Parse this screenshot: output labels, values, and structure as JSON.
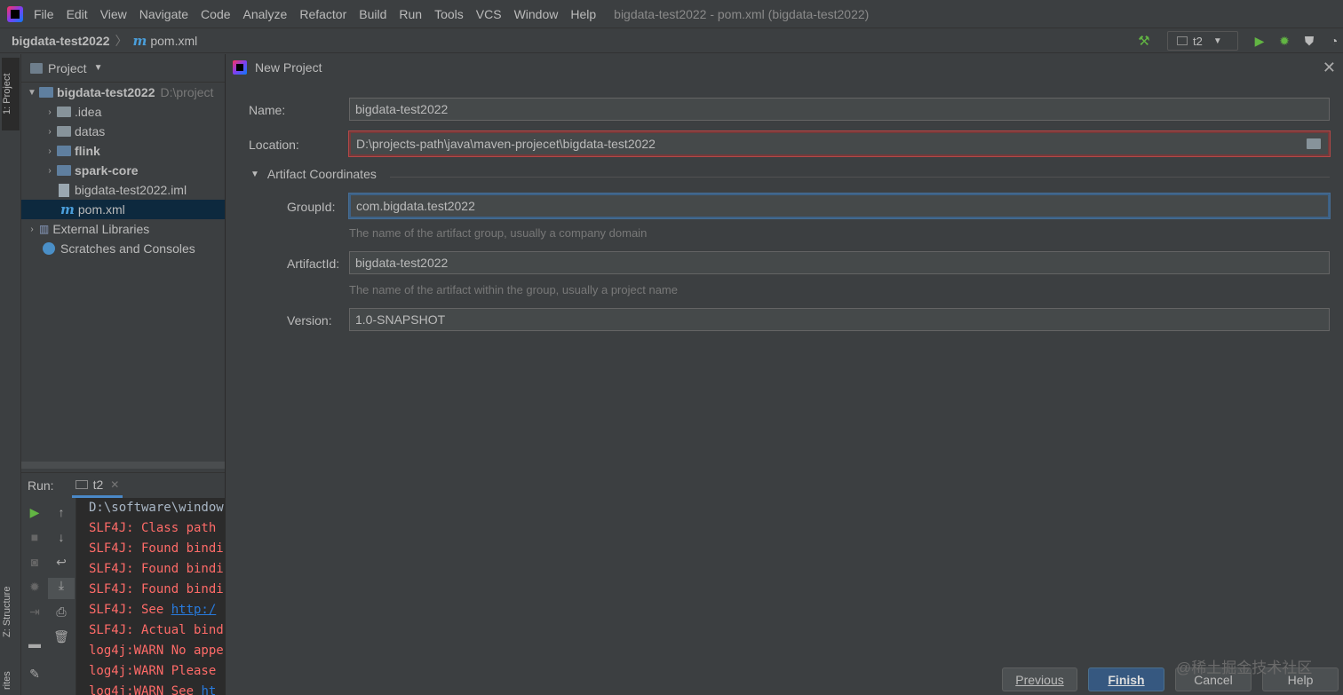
{
  "menubar": {
    "items": [
      "File",
      "Edit",
      "View",
      "Navigate",
      "Code",
      "Analyze",
      "Refactor",
      "Build",
      "Run",
      "Tools",
      "VCS",
      "Window",
      "Help"
    ],
    "title": "bigdata-test2022 - pom.xml (bigdata-test2022)"
  },
  "navbar": {
    "project": "bigdata-test2022",
    "file": "pom.xml",
    "run_config": "t2"
  },
  "left_strip": {
    "project_tab": "1: Project",
    "structure_tab": "Z: Structure",
    "favorites_tab": "rites"
  },
  "project_panel": {
    "title": "Project",
    "root": {
      "name": "bigdata-test2022",
      "path": "D:\\project"
    },
    "items": [
      ".idea",
      "datas",
      "flink",
      "spark-core",
      "bigdata-test2022.iml",
      "pom.xml"
    ],
    "external": "External Libraries",
    "scratches": "Scratches and Consoles"
  },
  "run_panel": {
    "label": "Run:",
    "tab": "t2",
    "lines": [
      "D:\\software\\window",
      "SLF4J: Class path",
      "SLF4J: Found bindi",
      "SLF4J: Found bindi",
      "SLF4J: Found bindi",
      "SLF4J: See ",
      "SLF4J: Actual bind",
      "log4j:WARN No appe",
      "log4j:WARN Please ",
      "log4j:WARN See "
    ],
    "links": [
      "http:/",
      "ht"
    ]
  },
  "dialog": {
    "title": "New Project",
    "name_label": "Name:",
    "name_value": "bigdata-test2022",
    "location_label": "Location:",
    "location_value": "D:\\projects-path\\java\\maven-projecet\\bigdata-test2022",
    "section": "Artifact Coordinates",
    "groupid_label": "GroupId:",
    "groupid_value": "com.bigdata.test2022",
    "groupid_hint": "The name of the artifact group, usually a company domain",
    "artifactid_label": "ArtifactId:",
    "artifactid_value": "bigdata-test2022",
    "artifactid_hint": "The name of the artifact within the group, usually a project name",
    "version_label": "Version:",
    "version_value": "1.0-SNAPSHOT",
    "buttons": {
      "previous": "Previous",
      "finish": "Finish",
      "cancel": "Cancel",
      "help": "Help"
    }
  },
  "watermark": "@稀土掘金技术社区"
}
